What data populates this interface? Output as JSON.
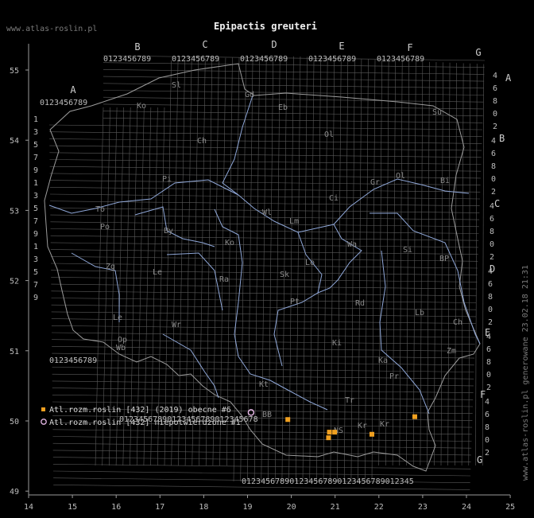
{
  "title": "Epipactis greuteri",
  "site": "www.atlas-roslin.pl",
  "generated": "www.atlas-roslin.pl generowane 23.02.18 21:31",
  "axis": {
    "x_ticks": [
      "14",
      "15",
      "16",
      "17",
      "18",
      "19",
      "20",
      "21",
      "22",
      "23",
      "24",
      "25"
    ],
    "y_ticks": [
      "55",
      "54",
      "53",
      "52",
      "51",
      "50",
      "49"
    ]
  },
  "grid_letters": {
    "top": [
      "A",
      "B",
      "C",
      "D",
      "E",
      "F",
      "G"
    ],
    "right": [
      "A",
      "B",
      "C",
      "D",
      "E",
      "F",
      "G"
    ]
  },
  "top_digits_row1": "0123456789",
  "right_digits": [
    "4",
    "6",
    "8",
    "0",
    "2"
  ],
  "left_digits": [
    "1",
    "3",
    "5",
    "7",
    "9"
  ],
  "regions": [
    "Sl",
    "Ko",
    "Gd",
    "Eb",
    "Ol",
    "Su",
    "Ch",
    "Bi",
    "Pi",
    "Ci",
    "Gr",
    "Ol",
    "To",
    "By",
    "Wl",
    "Lm",
    "Wa",
    "Si",
    "BP",
    "Po",
    "Ko",
    "Zg",
    "Le",
    "Lo",
    "Ra",
    "Sk",
    "Pt",
    "Rd",
    "Lb",
    "Ch",
    "Le",
    "Wr",
    "Op",
    "Ki",
    "Zm",
    "Wb",
    "Kt",
    "Ka",
    "Tr",
    "Pr",
    "Kr",
    "BB",
    "NS",
    "Kr"
  ],
  "legend": [
    {
      "label": "Atl.rozm.roslin [432] (2019) obecne #6",
      "color": "#f0a020",
      "shape": "square"
    },
    {
      "label": "Atl.rozm.roslin [432] niepotwierdzone #1",
      "color": "#e6b8e6",
      "shape": "circle"
    }
  ],
  "records_present": [
    {
      "lon": 19.92,
      "lat": 50.02
    },
    {
      "lon": 20.87,
      "lat": 49.84
    },
    {
      "lon": 20.99,
      "lat": 49.84
    },
    {
      "lon": 20.85,
      "lat": 49.76
    },
    {
      "lon": 21.84,
      "lat": 49.81
    },
    {
      "lon": 22.82,
      "lat": 50.06
    }
  ],
  "records_unconfirmed": [
    {
      "lon": 19.08,
      "lat": 50.12
    }
  ]
}
